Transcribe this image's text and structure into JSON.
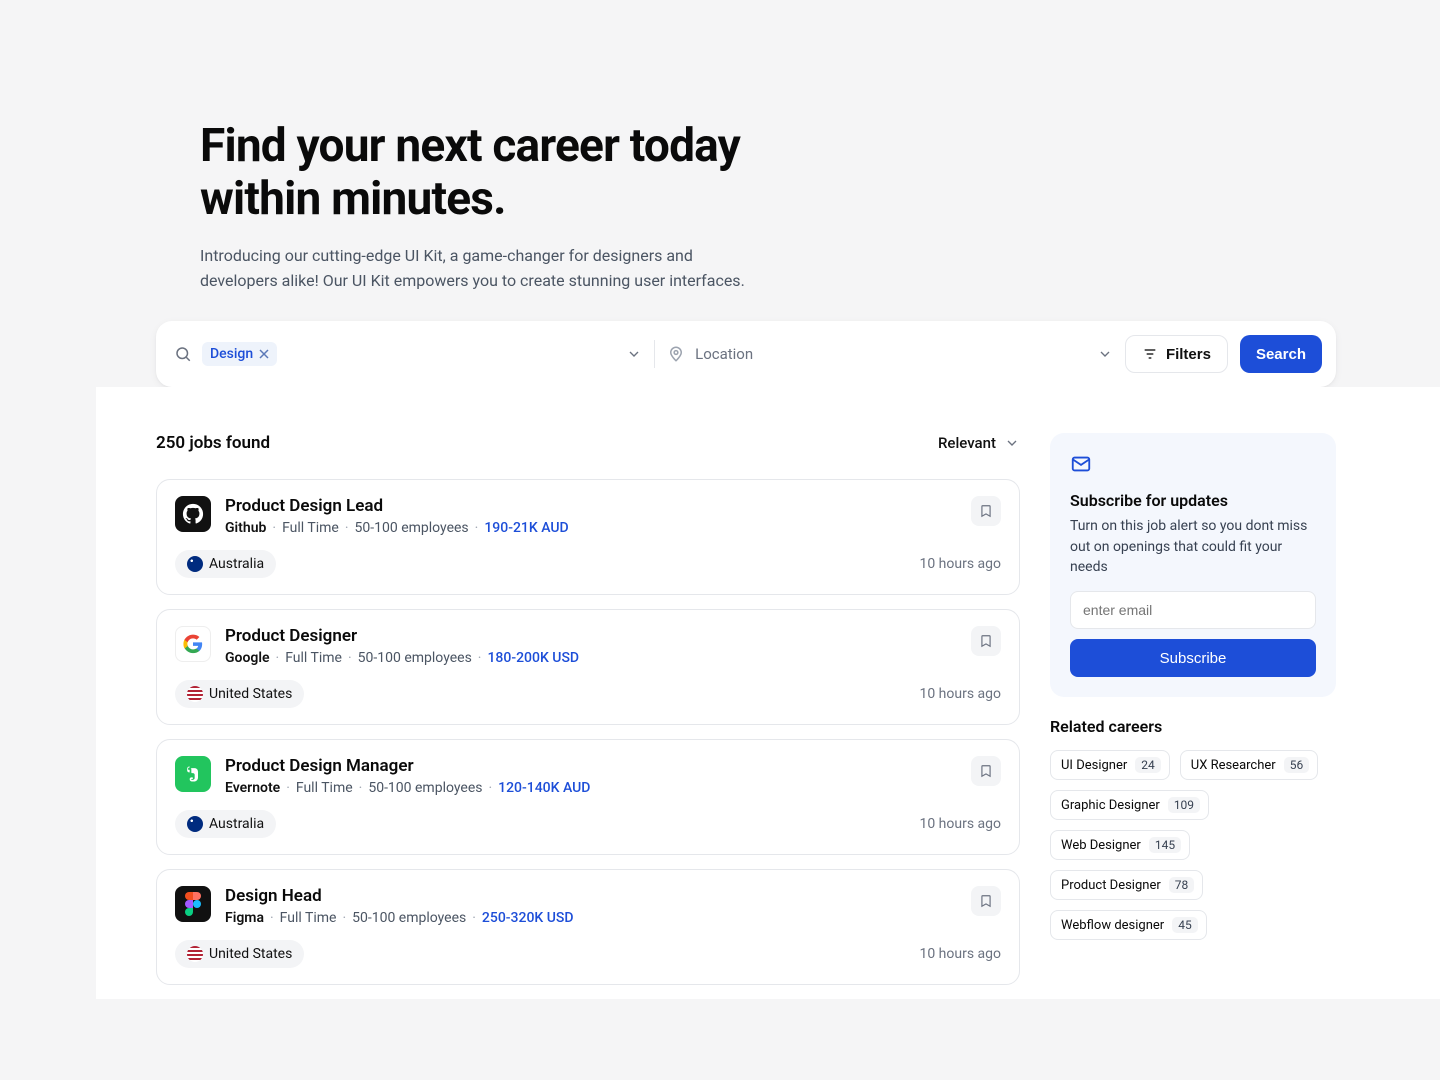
{
  "hero": {
    "title_line1": "Find your next career today",
    "title_line2": "within minutes.",
    "subtitle": "Introducing our cutting-edge UI Kit, a game-changer for designers and developers alike! Our UI Kit empowers you to create stunning user interfaces."
  },
  "search": {
    "chip_label": "Design",
    "location_placeholder": "Location",
    "filters_label": "Filters",
    "search_label": "Search"
  },
  "results": {
    "count_text": "250 jobs found",
    "sort_label": "Relevant"
  },
  "jobs": [
    {
      "title": "Product Design Lead",
      "company": "Github",
      "type": "Full Time",
      "size": "50-100 employees",
      "salary": "190-21K AUD",
      "location": "Australia",
      "flag": "au",
      "posted": "10 hours ago",
      "logo": "github"
    },
    {
      "title": "Product Designer",
      "company": "Google",
      "type": "Full Time",
      "size": "50-100 employees",
      "salary": "180-200K USD",
      "location": "United States",
      "flag": "us",
      "posted": "10 hours ago",
      "logo": "google"
    },
    {
      "title": "Product Design Manager",
      "company": "Evernote",
      "type": "Full Time",
      "size": "50-100 employees",
      "salary": "120-140K AUD",
      "location": "Australia",
      "flag": "au",
      "posted": "10 hours ago",
      "logo": "evernote"
    },
    {
      "title": "Design Head",
      "company": "Figma",
      "type": "Full Time",
      "size": "50-100 employees",
      "salary": "250-320K USD",
      "location": "United States",
      "flag": "us",
      "posted": "10 hours ago",
      "logo": "figma"
    }
  ],
  "subscribe": {
    "title": "Subscribe for updates",
    "body": "Turn on this job alert so you dont miss out on openings that could fit your needs",
    "placeholder": "enter email",
    "button": "Subscribe"
  },
  "related": {
    "title": "Related careers",
    "items": [
      {
        "label": "UI Designer",
        "count": "24"
      },
      {
        "label": "UX Researcher",
        "count": "56"
      },
      {
        "label": "Graphic Designer",
        "count": "109"
      },
      {
        "label": "Web Designer",
        "count": "145"
      },
      {
        "label": "Product Designer",
        "count": "78"
      },
      {
        "label": "Webflow designer",
        "count": "45"
      }
    ]
  }
}
